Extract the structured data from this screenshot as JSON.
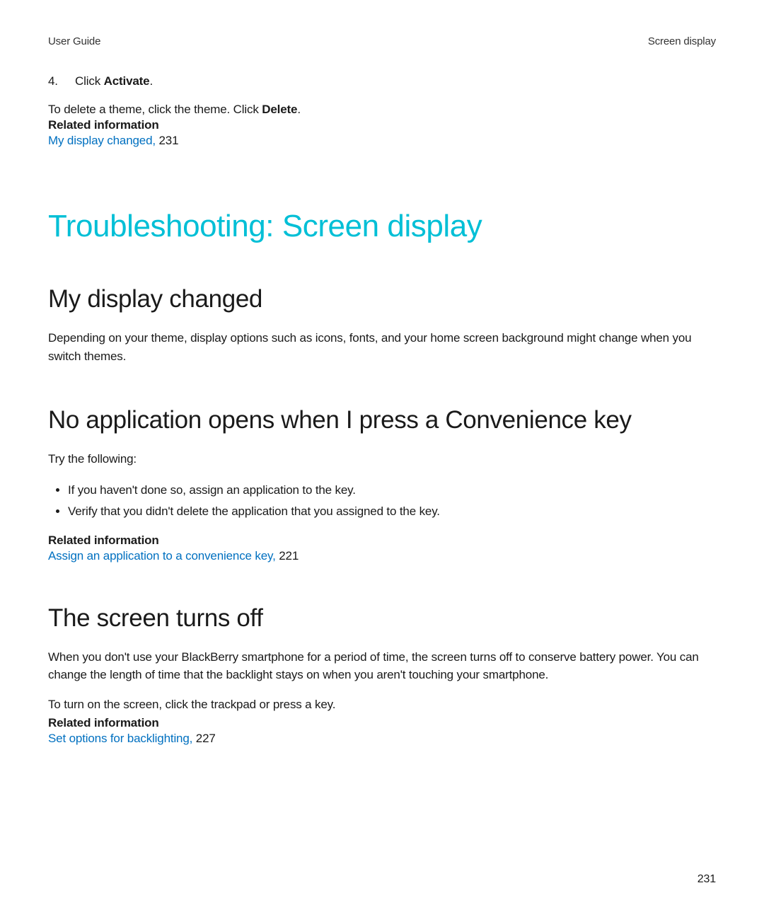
{
  "header": {
    "left": "User Guide",
    "right": "Screen display"
  },
  "step": {
    "number": "4.",
    "prefix": "Click ",
    "bold": "Activate",
    "suffix": "."
  },
  "deleteLine": {
    "prefix": "To delete a theme, click the theme. Click ",
    "bold": "Delete",
    "suffix": "."
  },
  "related1": {
    "heading": "Related information",
    "linkText": "My display changed,",
    "pageRef": " 231"
  },
  "mainTitle": "Troubleshooting: Screen display",
  "section1": {
    "title": "My display changed",
    "body": "Depending on your theme, display options such as icons, fonts, and your home screen background might change when you switch themes."
  },
  "section2": {
    "title": "No application opens when I press a Convenience key",
    "intro": "Try the following:",
    "bullets": [
      "If you haven't done so, assign an application to the key.",
      "Verify that you didn't delete the application that you assigned to the key."
    ],
    "related": {
      "heading": "Related information",
      "linkText": "Assign an application to a convenience key,",
      "pageRef": " 221"
    }
  },
  "section3": {
    "title": "The screen turns off",
    "body1": "When you don't use your BlackBerry smartphone for a period of time, the screen turns off to conserve battery power. You can change the length of time that the backlight stays on when you aren't touching your smartphone.",
    "body2": "To turn on the screen, click the trackpad or press a key.",
    "related": {
      "heading": "Related information",
      "linkText": "Set options for backlighting,",
      "pageRef": " 227"
    }
  },
  "pageNumber": "231"
}
